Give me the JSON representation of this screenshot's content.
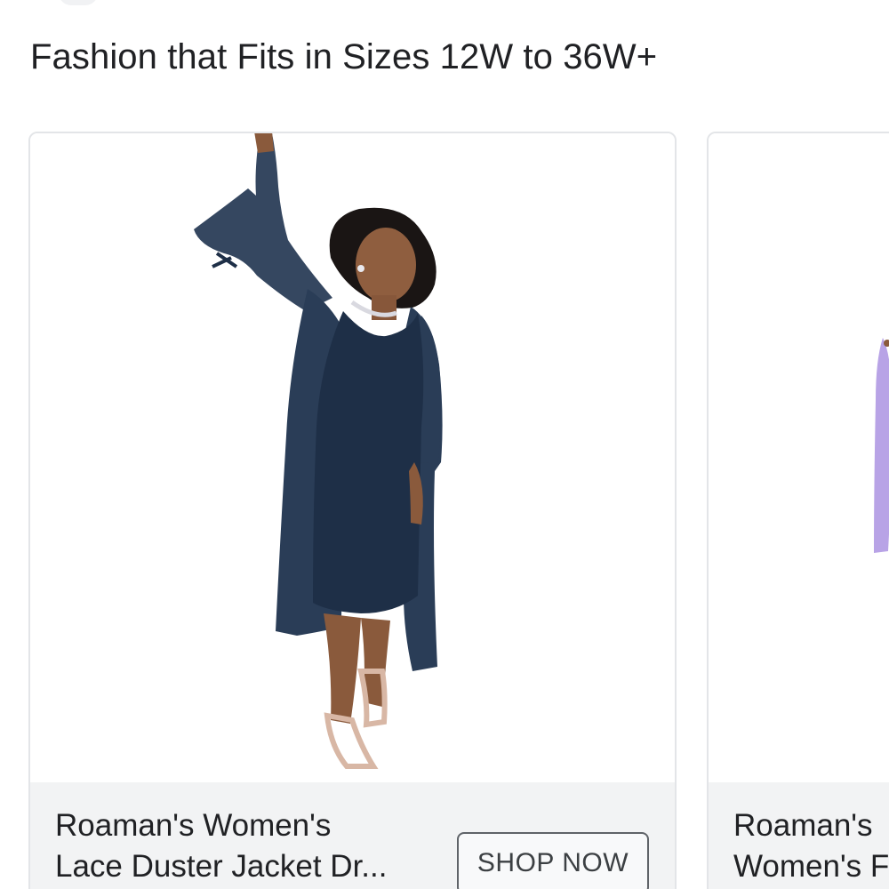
{
  "section": {
    "title": "Fashion that Fits in Sizes 12W to 36W+"
  },
  "cards": [
    {
      "title_line1": "Roaman's Women's",
      "title_line2": "Lace Duster Jacket Dr...",
      "cta_label": "SHOP NOW",
      "image_alt": "model-in-navy-lace-duster-dress"
    },
    {
      "title_line1": "Roaman's",
      "title_line2": "Women's F",
      "image_alt": "model-in-lavender-outfit"
    }
  ],
  "colors": {
    "navy_garment": "#1e2f47",
    "lace": "#2a3d57",
    "skin": "#8a5a3c",
    "lavender": "#b8a3e6",
    "footer_bg": "#f2f3f4",
    "card_border": "#e3e5e8",
    "text": "#202124"
  }
}
